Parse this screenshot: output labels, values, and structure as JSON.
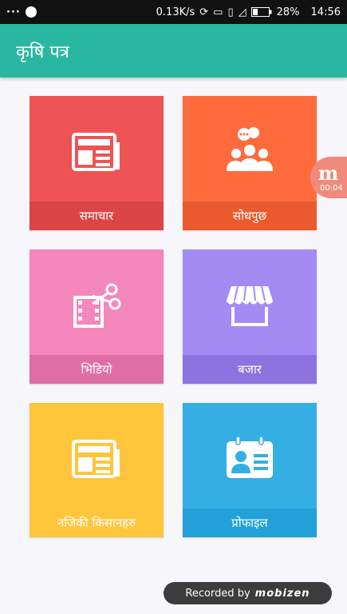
{
  "status_bar": {
    "left_dots": "···",
    "speed": "0.13K/s",
    "battery": "28%",
    "time": "14:56"
  },
  "app_bar": {
    "title": "कृषि पत्र"
  },
  "tiles": [
    {
      "label": "समाचार",
      "icon": "newspaper-icon",
      "color": "#ee5455",
      "label_bg": "#dc4546"
    },
    {
      "label": "सोधपुछ",
      "icon": "group-chat-icon",
      "color": "#ff6b3d",
      "label_bg": "#ea5a2e"
    },
    {
      "label": "भिडियो",
      "icon": "video-edit-icon",
      "color": "#f488bd",
      "label_bg": "#df6ea6"
    },
    {
      "label": "बजार",
      "icon": "market-stall-icon",
      "color": "#a28cf3",
      "label_bg": "#8b74e0"
    },
    {
      "label": "नजिकी किसानहरु",
      "icon": "newspaper-icon",
      "color": "#ffc63b",
      "label_bg": "#ffc63b"
    },
    {
      "label": "प्रोफाइल",
      "icon": "profile-card-icon",
      "color": "#35aee3",
      "label_bg": "#22a1d8"
    }
  ],
  "overlay": {
    "mobizen_letter": "m",
    "mobizen_timer": "00:04",
    "recorded_by": "Recorded by",
    "recorded_brand": "mobizen"
  }
}
